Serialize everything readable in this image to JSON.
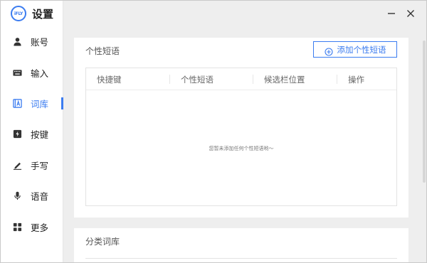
{
  "app": {
    "logo_text": "iFLY",
    "title": "设置"
  },
  "sidebar": {
    "items": [
      {
        "label": "账号",
        "icon": "user-icon",
        "active": false
      },
      {
        "label": "输入",
        "icon": "keyboard-icon",
        "active": false
      },
      {
        "label": "词库",
        "icon": "lexicon-icon",
        "active": true
      },
      {
        "label": "按键",
        "icon": "key-icon",
        "active": false
      },
      {
        "label": "手写",
        "icon": "pen-icon",
        "active": false
      },
      {
        "label": "语音",
        "icon": "microphone-icon",
        "active": false
      },
      {
        "label": "更多",
        "icon": "grid-icon",
        "active": false
      }
    ]
  },
  "titlebar": {
    "minimize_icon": "minimize-icon",
    "close_icon": "close-icon"
  },
  "phrases_card": {
    "title": "个性短语",
    "add_button_label": "添加个性短语",
    "columns": [
      "快捷键",
      "个性短语",
      "候选栏位置",
      "操作"
    ],
    "empty_text": "您暂未添加任何个性短语哟～"
  },
  "category_card": {
    "title": "分类词库"
  },
  "colors": {
    "accent": "#3b7cf0",
    "background": "#eeeeee",
    "card": "#ffffff"
  }
}
